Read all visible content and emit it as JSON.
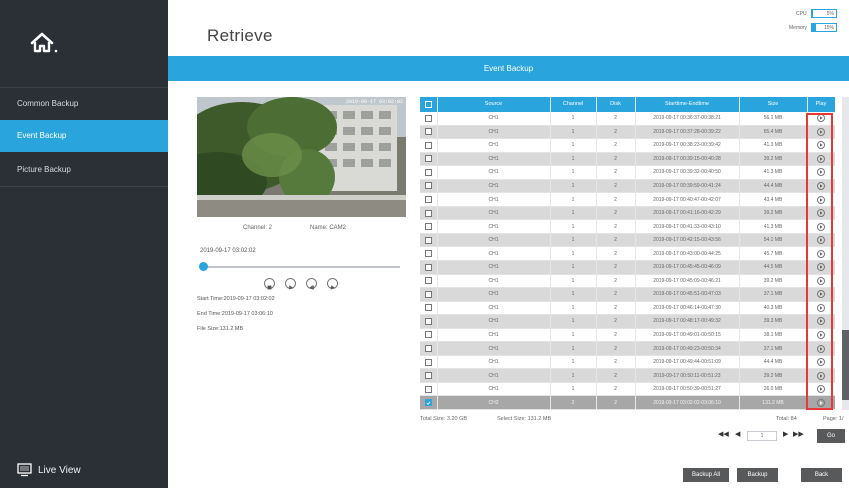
{
  "page_title": "Retrieve",
  "sidebar": {
    "items": [
      {
        "label": "Common Backup",
        "active": false
      },
      {
        "label": "Event Backup",
        "active": true
      },
      {
        "label": "Picture Backup",
        "active": false
      }
    ],
    "live_view": "Live View"
  },
  "system": {
    "cpu_label": "CPU",
    "cpu_value": "5%",
    "cpu_fraction": 0.05,
    "memory_label": "Memory",
    "memory_value": "15%",
    "memory_fraction": 0.15
  },
  "banner_title": "Event Backup",
  "preview": {
    "timestamp": "2019-09-17 03:02:02",
    "channel_label": "Channel: 2",
    "name_label": "Name: CAM2",
    "current_time": "2019-09-17 03:02:02",
    "progress": 0.0,
    "start_time": "Start Time:2019-09-17 03:02:02",
    "end_time": "End Time:2019-09-17 03:06:10",
    "file_size": "File Size:131.2 MB"
  },
  "table": {
    "columns": [
      "Source",
      "Channel",
      "Disk",
      "Starttime-Endtime",
      "Size",
      "Play"
    ],
    "rows": [
      {
        "source": "CH1",
        "channel": "1",
        "disk": "2",
        "time": "2019-09-17 00:36:37-00:38:21",
        "size": "56.1 MB",
        "checked": false
      },
      {
        "source": "CH1",
        "channel": "1",
        "disk": "2",
        "time": "2019-09-17 00:37:28-00:39:22",
        "size": "65.4 MB",
        "checked": false
      },
      {
        "source": "CH1",
        "channel": "1",
        "disk": "2",
        "time": "2019-09-17 00:38:23-00:39:42",
        "size": "41.3 MB",
        "checked": false
      },
      {
        "source": "CH1",
        "channel": "1",
        "disk": "2",
        "time": "2019-09-17 00:39:15-00:40:28",
        "size": "39.2 MB",
        "checked": false
      },
      {
        "source": "CH1",
        "channel": "1",
        "disk": "2",
        "time": "2019-09-17 00:39:32-00:40:50",
        "size": "41.3 MB",
        "checked": false
      },
      {
        "source": "CH1",
        "channel": "1",
        "disk": "2",
        "time": "2019-09-17 00:39:59-00:41:24",
        "size": "44.4 MB",
        "checked": false
      },
      {
        "source": "CH1",
        "channel": "1",
        "disk": "2",
        "time": "2019-09-17 00:40:47-00:42:07",
        "size": "43.4 MB",
        "checked": false
      },
      {
        "source": "CH1",
        "channel": "1",
        "disk": "2",
        "time": "2019-09-17 00:41:16-00:42:29",
        "size": "39.2 MB",
        "checked": false
      },
      {
        "source": "CH1",
        "channel": "1",
        "disk": "2",
        "time": "2019-09-17 00:41:33-00:43:10",
        "size": "41.3 MB",
        "checked": false
      },
      {
        "source": "CH1",
        "channel": "1",
        "disk": "2",
        "time": "2019-09-17 00:42:15-00:43:56",
        "size": "54.1 MB",
        "checked": false
      },
      {
        "source": "CH1",
        "channel": "1",
        "disk": "2",
        "time": "2019-09-17 00:43:00-00:44:25",
        "size": "45.7 MB",
        "checked": false
      },
      {
        "source": "CH1",
        "channel": "1",
        "disk": "2",
        "time": "2019-09-17 00:45:45-00:46:09",
        "size": "44.5 MB",
        "checked": false
      },
      {
        "source": "CH1",
        "channel": "1",
        "disk": "2",
        "time": "2019-09-17 00:45:09-00:46:21",
        "size": "39.2 MB",
        "checked": false
      },
      {
        "source": "CH1",
        "channel": "1",
        "disk": "2",
        "time": "2019-09-17 00:45:51-00:47:03",
        "size": "37.1 MB",
        "checked": false
      },
      {
        "source": "CH1",
        "channel": "1",
        "disk": "2",
        "time": "2019-09-17 00:46:14-00:47:30",
        "size": "40.3 MB",
        "checked": false
      },
      {
        "source": "CH1",
        "channel": "1",
        "disk": "2",
        "time": "2019-09-17 00:48:17-00:49:32",
        "size": "39.3 MB",
        "checked": false
      },
      {
        "source": "CH1",
        "channel": "1",
        "disk": "2",
        "time": "2019-09-17 00:49:01-00:50:15",
        "size": "38.1 MB",
        "checked": false
      },
      {
        "source": "CH1",
        "channel": "1",
        "disk": "2",
        "time": "2019-09-17 00:49:23-00:50:34",
        "size": "37.1 MB",
        "checked": false
      },
      {
        "source": "CH1",
        "channel": "1",
        "disk": "2",
        "time": "2019-09-17 00:49:44-00:51:09",
        "size": "44.4 MB",
        "checked": false
      },
      {
        "source": "CH1",
        "channel": "1",
        "disk": "2",
        "time": "2019-09-17 00:50:11-00:51:23",
        "size": "39.2 MB",
        "checked": false
      },
      {
        "source": "CH1",
        "channel": "1",
        "disk": "2",
        "time": "2019-09-17 00:50:39-00:51:27",
        "size": "26.0 MB",
        "checked": false
      },
      {
        "source": "CH2",
        "channel": "2",
        "disk": "2",
        "time": "2019-09-17 03:02:02-03:06:10",
        "size": "131.2 MB",
        "checked": true
      }
    ]
  },
  "totals": {
    "total_size": "Total Size: 3.20 GB",
    "select_size": "Select Size: 131.2 MB",
    "total_count": "Total: 84",
    "page": "Page: 1/"
  },
  "pager": {
    "first": "◀◀",
    "prev": "◀",
    "page_value": "1",
    "next": "▶",
    "last": "▶▶",
    "go": "Go"
  },
  "actions": {
    "backup_all": "Backup All",
    "backup": "Backup",
    "back": "Back"
  },
  "colors": {
    "accent": "#29a4dd",
    "sidebar": "#2b2f36",
    "button": "#58595b",
    "highlight": "#e53935"
  }
}
